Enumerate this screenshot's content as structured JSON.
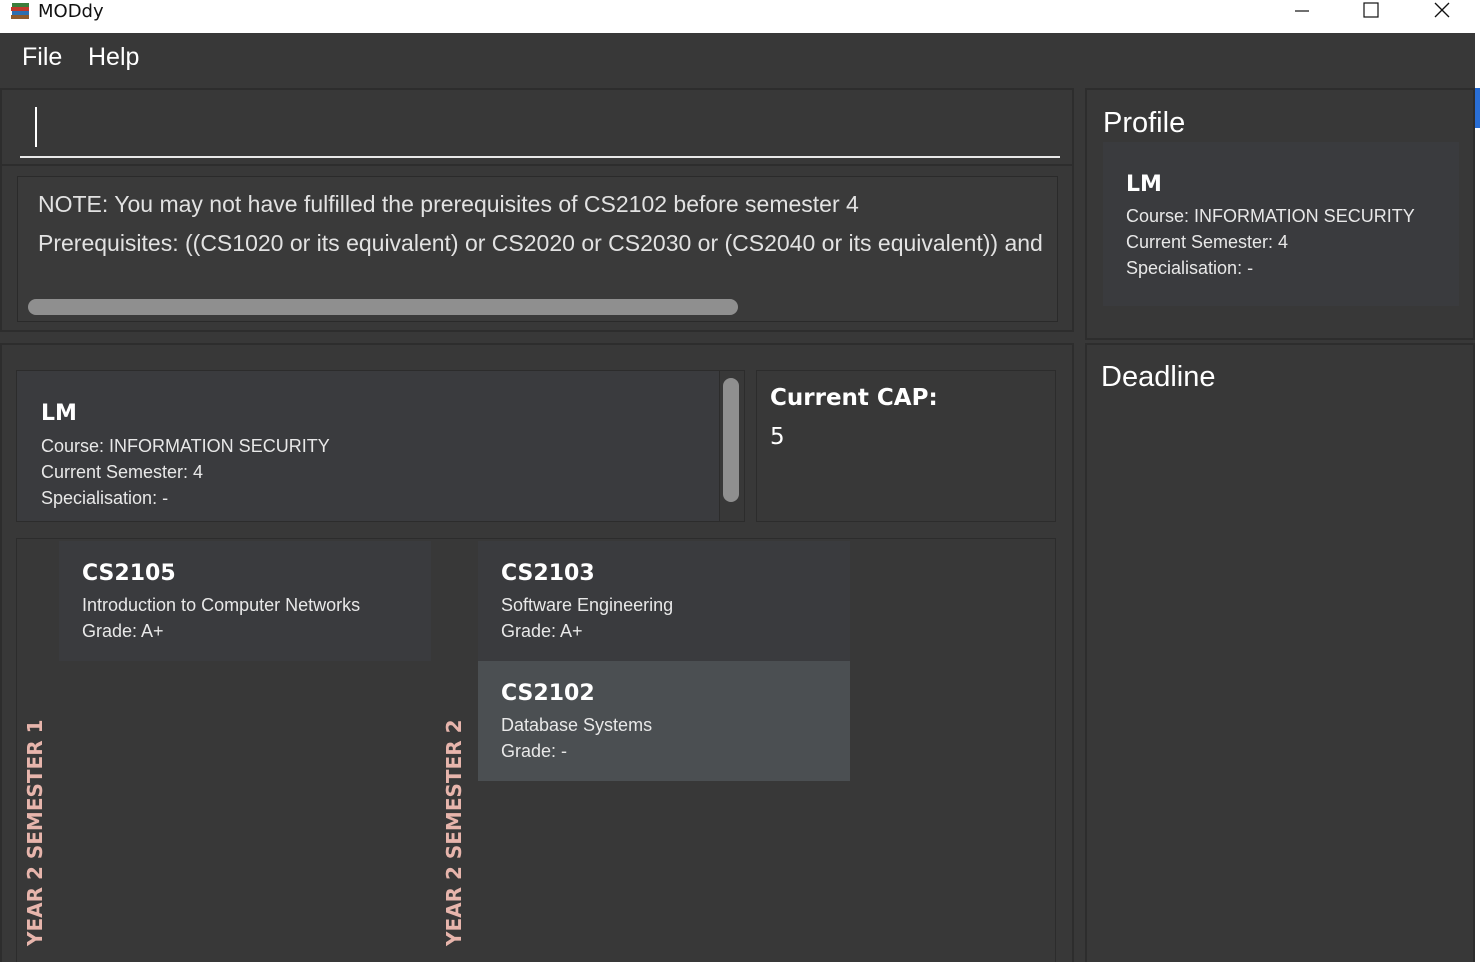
{
  "window": {
    "title": "MODdy"
  },
  "menu": {
    "file": "File",
    "help": "Help"
  },
  "command": {
    "value": ""
  },
  "result": {
    "line1": "NOTE: You may not have fulfilled the prerequisites of CS2102 before semester 4",
    "line2": "Prerequisites: ((CS1020 or its equivalent) or CS2020 or CS2030 or (CS2040 or its equivalent)) and"
  },
  "student": {
    "name": "LM",
    "course": "Course: INFORMATION SECURITY",
    "semester": "Current Semester: 4",
    "specialisation": "Specialisation: -"
  },
  "cap": {
    "label": "Current CAP:",
    "value": "5"
  },
  "semesters": [
    {
      "label": "YEAR 2 SEMESTER 1",
      "modules": [
        {
          "code": "CS2105",
          "title": "Introduction to Computer Networks",
          "grade": "Grade: A+"
        }
      ]
    },
    {
      "label": "YEAR 2 SEMESTER 2",
      "modules": [
        {
          "code": "CS2103",
          "title": "Software Engineering",
          "grade": "Grade: A+"
        },
        {
          "code": "CS2102",
          "title": "Database Systems",
          "grade": "Grade: -"
        }
      ]
    }
  ],
  "profile": {
    "header": "Profile",
    "name": "LM",
    "course": "Course: INFORMATION SECURITY",
    "semester": "Current Semester: 4",
    "specialisation": "Specialisation: -"
  },
  "deadline": {
    "header": "Deadline"
  },
  "icons": {
    "app": "books-icon",
    "minimize": "minimize-icon",
    "maximize": "maximize-icon",
    "close": "close-icon"
  },
  "colors": {
    "background": "#383838",
    "card": "#3a3b3e",
    "selected_card": "#4b4f52",
    "semester_label": "#e7b5ac"
  }
}
